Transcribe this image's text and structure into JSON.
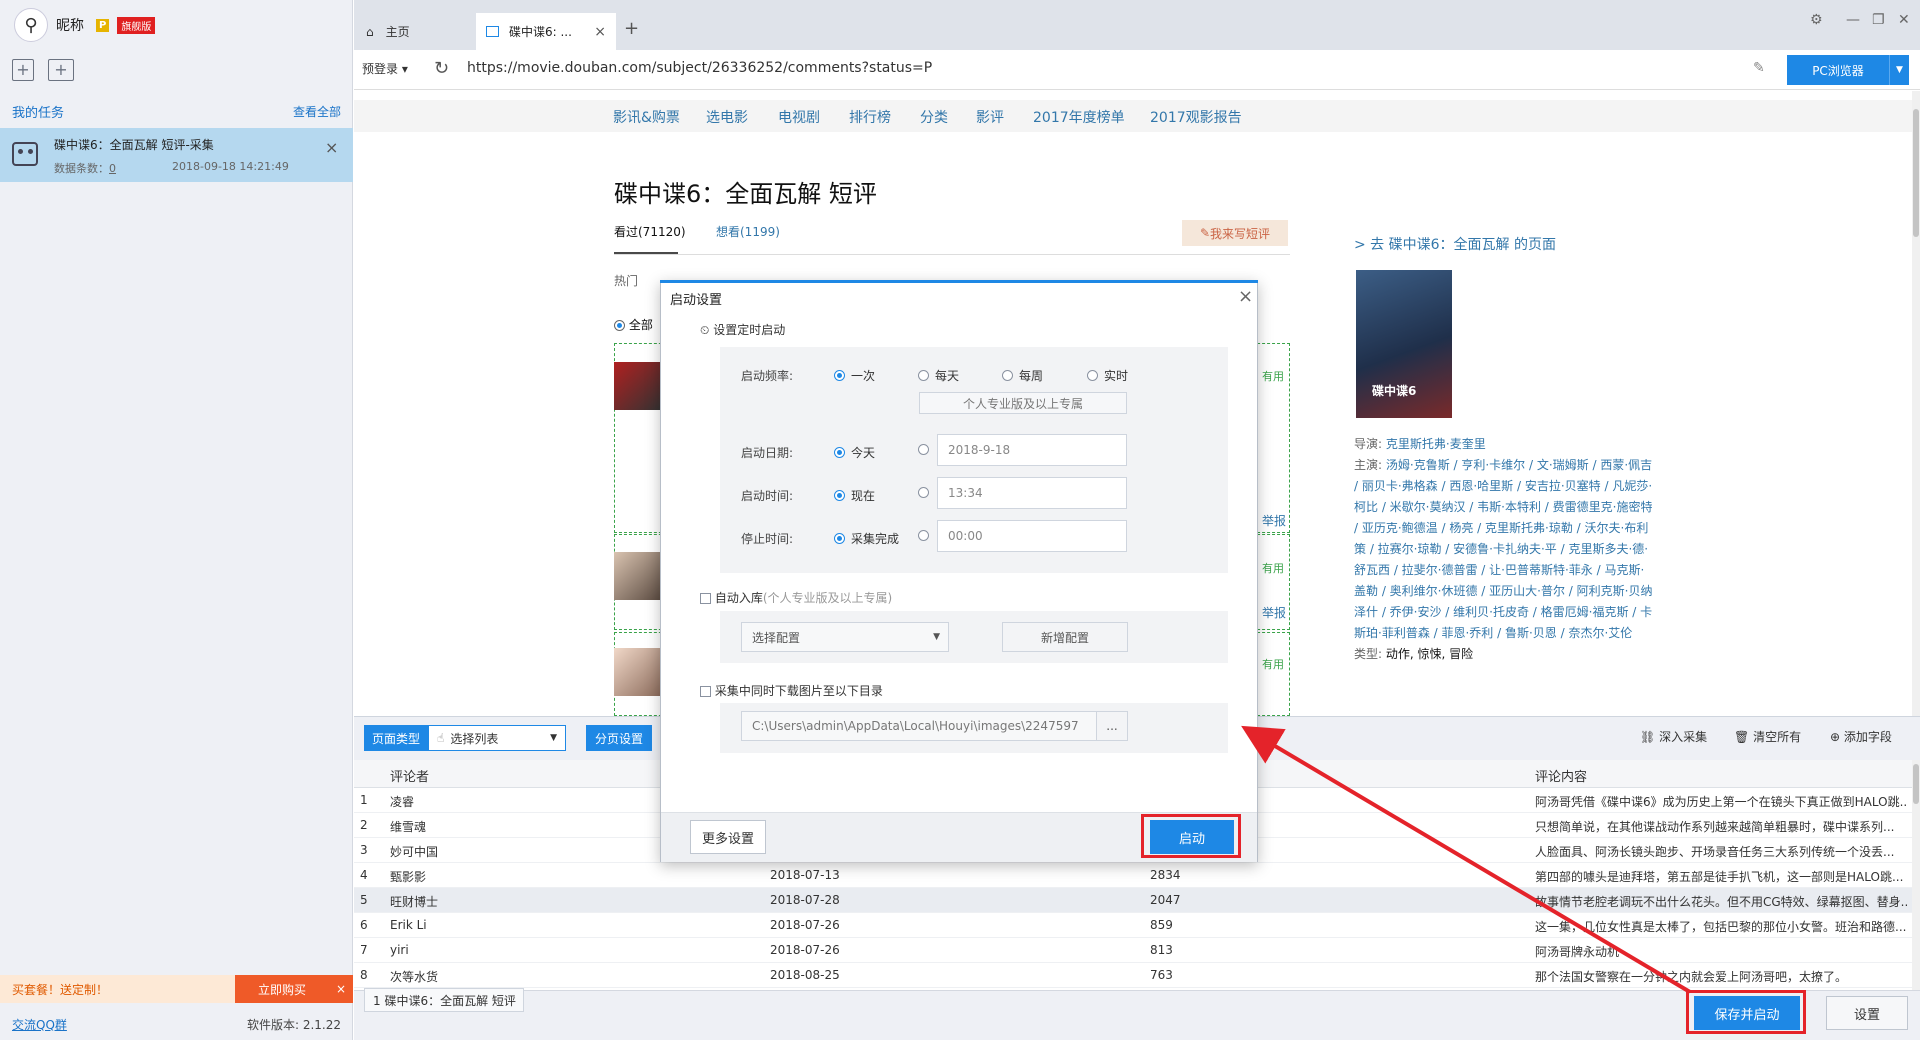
{
  "sidebar": {
    "nickname": "昵称",
    "badge_p": "P",
    "badge_flag": "旗舰版",
    "my_tasks": "我的任务",
    "view_all": "查看全部",
    "task": {
      "name": "碟中谍6：全面瓦解 短评-采集",
      "count_label": "数据条数：",
      "count_value": "0",
      "time": "2018-09-18 14:21:49"
    },
    "promo": {
      "text": "买套餐！送定制！",
      "buy": "立即购买"
    },
    "qq_group": "交流QQ群",
    "version": "软件版本: 2.1.22"
  },
  "tabs": {
    "home": "主页",
    "active": "碟中谍6: ..."
  },
  "address": {
    "preset": "预登录",
    "url": "https://movie.douban.com/subject/26336252/comments?status=P",
    "pc_browser": "PC浏览器"
  },
  "webpage": {
    "nav": [
      "影讯&购票",
      "选电影",
      "电视剧",
      "排行榜",
      "分类",
      "影评",
      "2017年度榜单",
      "2017观影报告"
    ],
    "title": "碟中谍6：全面瓦解 短评",
    "tab_seen": "看过(71120)",
    "tab_want": "想看(1199)",
    "write": "我来写短评",
    "hot_row": "热门",
    "filter_all": "全部",
    "useful": "有用",
    "report": "举报",
    "side_link": "> 去 碟中谍6：全面瓦解 的页面",
    "director_label": "导演:",
    "director": "克里斯托弗·麦奎里",
    "cast_label": "主演:",
    "cast": "汤姆·克鲁斯 / 亨利·卡维尔 / 文·瑞姆斯 / 西蒙·佩吉 / 丽贝卡·弗格森 / 西恩·哈里斯 / 安吉拉·贝塞特 / 凡妮莎·柯比 / 米歇尔·莫纳汉 / 韦斯·本特利 / 费雷德里克·施密特 / 亚历克·鲍德温 / 杨亮 / 克里斯托弗·琼勒 / 沃尔夫·布利策 / 拉赛尔·琼勒 / 安德鲁·卡扎纳夫·平 / 克里斯多夫·德·舒瓦西 / 拉斐尔·德普雷 / 让·巴普蒂斯特·菲永 / 马克斯·盖勒 / 奥利维尔·休班德 / 亚历山大·普尔 / 阿利克斯·贝纳泽什 / 乔伊·安沙 / 维利贝·托皮奇 / 格雷厄姆·福克斯 / 卡斯珀·菲利普森 / 菲恩·乔利 / 鲁斯·贝恩 / 奈杰尔·艾伦",
    "genre_label": "类型:",
    "genre": "动作, 惊悚, 冒险"
  },
  "bottom_toolbar": {
    "page_type": "页面类型",
    "select_list": "选择列表",
    "pagination": "分页设置",
    "deep": "深入采集",
    "clear_all": "清空所有",
    "add_field": "添加字段"
  },
  "grid": {
    "columns": [
      "评论者",
      "",
      "",
      "评论内容"
    ],
    "rows": [
      {
        "n": "1",
        "user": "凌睿",
        "date": "",
        "votes": "",
        "content": "阿汤哥凭借《碟中谍6》成为历史上第一个在镜头下真正做到HALO跳..."
      },
      {
        "n": "2",
        "user": "维雪魂",
        "date": "",
        "votes": "",
        "content": "只想简单说，在其他谍战动作系列越来越简单粗暴时，碟中谍系列..."
      },
      {
        "n": "3",
        "user": "妙可中国",
        "date": "",
        "votes": "",
        "content": "人脸面具、阿汤长镜头跑步、开场录音任务三大系列传统一个没丢..."
      },
      {
        "n": "4",
        "user": "甄影影",
        "date": "2018-07-13",
        "votes": "2834",
        "content": "第四部的噱头是迪拜塔，第五部是徒手扒飞机，这一部则是HALO跳..."
      },
      {
        "n": "5",
        "user": "旺财博士",
        "date": "2018-07-28",
        "votes": "2047",
        "content": "故事情节老腔老调玩不出什么花头。但不用CG特效、绿幕抠图、替身..."
      },
      {
        "n": "6",
        "user": "Erik Li",
        "date": "2018-07-26",
        "votes": "859",
        "content": "这一集，几位女性真是太棒了，包括巴黎的那位小女警。班治和路德..."
      },
      {
        "n": "7",
        "user": "yiri",
        "date": "2018-07-26",
        "votes": "813",
        "content": "阿汤哥牌永动机"
      },
      {
        "n": "8",
        "user": "次等水货",
        "date": "2018-08-25",
        "votes": "763",
        "content": "那个法国女警察在一分钟之内就会爱上阿汤哥吧，太撩了。"
      }
    ]
  },
  "footer": {
    "task_tab": "1 碟中谍6：全面瓦解 短评",
    "save_start": "保存并启动",
    "settings": "设置"
  },
  "modal": {
    "title": "启动设置",
    "schedule": "设置定时启动",
    "freq_label": "启动频率:",
    "freq_once": "一次",
    "freq_daily": "每天",
    "freq_weekly": "每周",
    "freq_realtime": "实时",
    "pro_only": "个人专业版及以上专属",
    "date_label": "启动日期:",
    "date_today": "今天",
    "date_value": "2018-9-18",
    "time_label": "启动时间:",
    "time_now": "现在",
    "time_value": "13:34",
    "stop_label": "停止时间:",
    "stop_done": "采集完成",
    "stop_value": "00:00",
    "auto_db": "自动入库",
    "auto_db_note": "(个人专业版及以上专属)",
    "choose_config": "选择配置",
    "new_config": "新增配置",
    "download_images": "采集中同时下载图片至以下目录",
    "image_path": "C:\\Users\\admin\\AppData\\Local\\Houyi\\images\\2247597",
    "browse": "...",
    "more_settings": "更多设置",
    "start": "启动"
  },
  "colors": {
    "accent": "#1e88e5",
    "highlight": "#e4232a",
    "task_selected": "#b5d8ef"
  }
}
